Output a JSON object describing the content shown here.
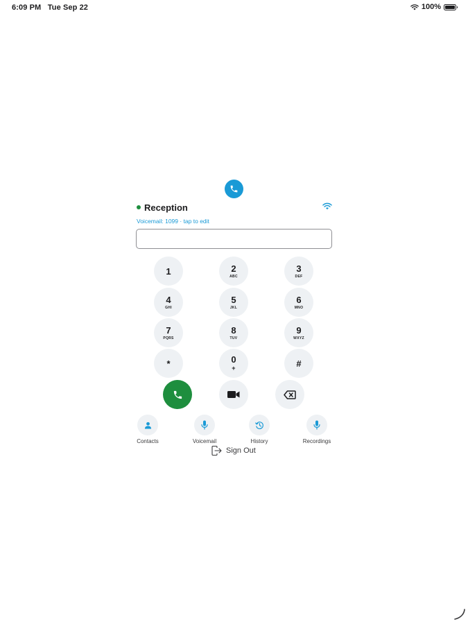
{
  "status_bar": {
    "time": "6:09 PM",
    "date": "Tue Sep 22",
    "battery": "100%"
  },
  "line": {
    "name": "Reception",
    "status_color": "#1e8e3e",
    "voicemail_hint": "Voicemail: 1099 · tap to edit"
  },
  "dial_input": {
    "value": "",
    "placeholder": ""
  },
  "keypad": [
    {
      "digit": "1",
      "letters": ""
    },
    {
      "digit": "2",
      "letters": "ABC"
    },
    {
      "digit": "3",
      "letters": "DEF"
    },
    {
      "digit": "4",
      "letters": "GHI"
    },
    {
      "digit": "5",
      "letters": "JKL"
    },
    {
      "digit": "6",
      "letters": "MNO"
    },
    {
      "digit": "7",
      "letters": "PQRS"
    },
    {
      "digit": "8",
      "letters": "TUV"
    },
    {
      "digit": "9",
      "letters": "WXYZ"
    },
    {
      "digit": "*",
      "letters": ""
    },
    {
      "digit": "0",
      "letters": "+"
    },
    {
      "digit": "#",
      "letters": ""
    }
  ],
  "actions": {
    "call_icon": "phone-icon",
    "video_icon": "video-camera-icon",
    "delete_icon": "backspace-icon"
  },
  "nav": {
    "contacts": "Contacts",
    "voicemail": "Voicemail",
    "history": "History",
    "recordings": "Recordings"
  },
  "signout_label": "Sign Out",
  "colors": {
    "accent": "#1a9ad6",
    "call_green": "#1e8e3e",
    "key_bg": "#eef1f4"
  }
}
